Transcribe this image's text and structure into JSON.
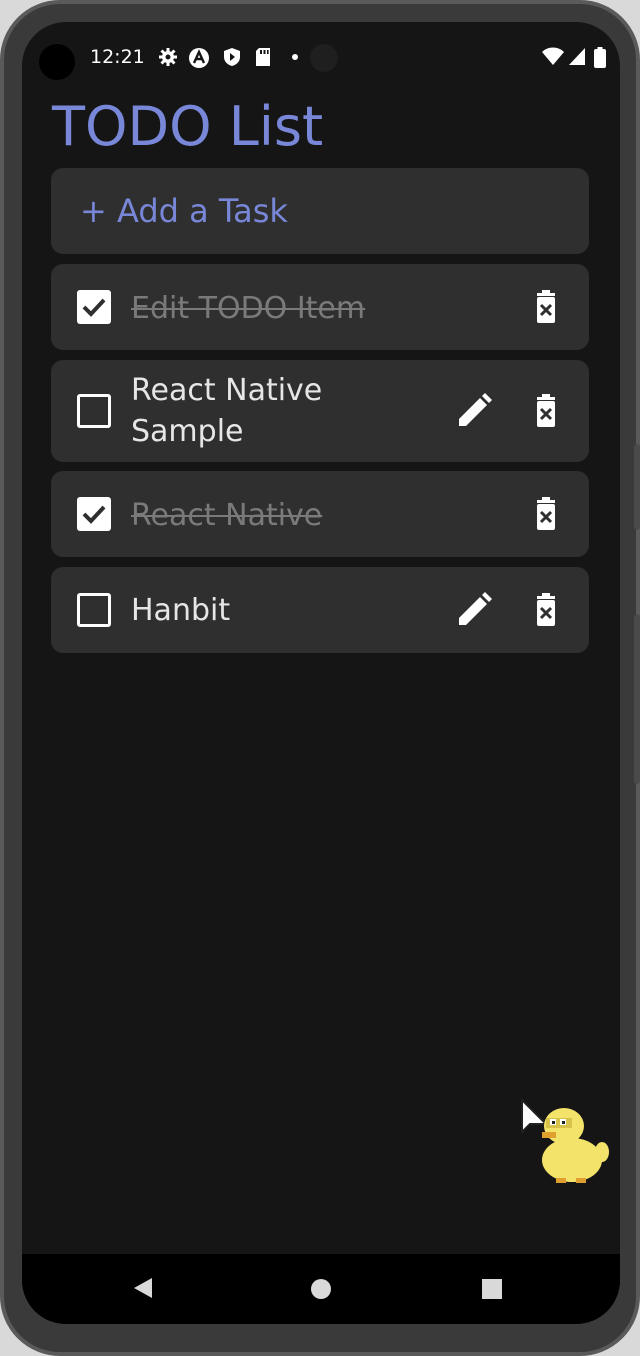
{
  "status_bar": {
    "time": "12:21",
    "icons": [
      "gear-icon",
      "app-a-icon",
      "shield-icon",
      "sd-card-icon",
      "dot-icon",
      "wifi-icon",
      "signal-icon",
      "battery-icon"
    ]
  },
  "app": {
    "title": "TODO List",
    "add_task_label": "+ Add a Task",
    "tasks": [
      {
        "text": "Edit TODO Item",
        "completed": true
      },
      {
        "text": "React Native Sample",
        "completed": false
      },
      {
        "text": "React Native",
        "completed": true
      },
      {
        "text": "Hanbit",
        "completed": false
      }
    ]
  },
  "navigation": {
    "icons": [
      "back-icon",
      "home-icon",
      "recents-icon"
    ]
  },
  "colors": {
    "accent": "#7987d8",
    "background": "#151515",
    "card": "#2f2f2f",
    "text": "#e6e6e6",
    "completed_text": "#7a7a7a"
  }
}
